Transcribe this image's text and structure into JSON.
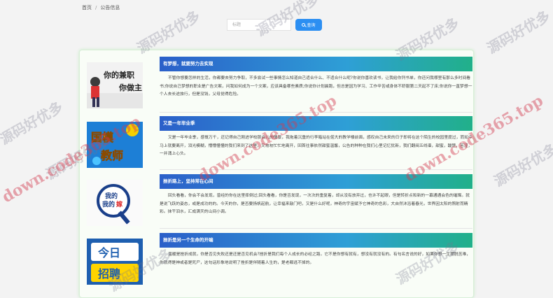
{
  "breadcrumb": {
    "home": "首页",
    "separator": "/",
    "current": "公告信息"
  },
  "search": {
    "placeholder": "标题",
    "button_label": "查询"
  },
  "articles": [
    {
      "title": "有梦想，就要努力去实现",
      "excerpt": "不管你想要怎样的生活，你都要去努力争取，不多尝试一些事情怎么知道自己适合什么、不适合什么呢?你说你喜欢读书，让我给你列书单，你还问我哪里有那么多时间看书;你说自己梦想的职业是广告文案，问我如何成为一个文案，应该具备哪些素质;你说你计划晨跑，但总是因为学习、工作辛苦或身体不舒服第二天起不了床;你说你一直梦想一个人去长途旅行，但是没钱，父母觉得危险。",
      "thumb_text": [
        "你的兼职",
        "你做主"
      ]
    },
    {
      "title": "又是一年毕业季",
      "excerpt": "又是一年毕业季，感慨万千，还记得自己刚进学校那会儿的情景，我拖着沉重的行李箱站在偌大的教学楼前面，感叹自己未来的日子即将在这个陌生的校园里度过，而如今马上就要离开，泪光模糊，懵懵懂懂的我们来到了这里，又匆匆忙忙地离开，回首往事依然甜蜜温馨，公告的种种在我们心里记忆犹新，我们翻阅五线谱，甜蜜，酸楚，苦涩，一并涌上心头。",
      "thumb_text": [
        "国模",
        "教师"
      ]
    },
    {
      "title": "挫折路上，坚持常在心间",
      "excerpt": "回头看看，你会不会发现，曾经的你在这里摔倒过;回头看看，你是否发现，一次次的重复着，却从没有放弃过，也许不起眼，但是转折点和新的一幕通通会色的璀璨。就是说飞跃的姿态，或是成功的的。今天的你，是否要扬帆起航，让幸福来敲门吧，又是什么好呢，神奇的宇宙赋予它神奇的色彩，大自然沐浴着春光，世界因太阳的照射而精彩。抹干泪水，汇成满天的山间小调。",
      "thumb_text": [
        "我的",
        "我的",
        "嫁"
      ]
    },
    {
      "title": "挫折是另一个生命的开端",
      "excerpt": "温暖是挫折成就，你是否见失败还是还是否见机会?挫折是我们每个人成长的必经之路，它不是你想有就有，想没有就没有的。有句名言说的好，如果你想一生摆脱苦难，你就得是神或者是死尸，这句话形象地说明了挫折是伴随着人生的，是老都逃不掉的。",
      "thumb_text": [
        "今日",
        "招聘"
      ]
    }
  ],
  "watermarks": {
    "site_cn": "源码好优多",
    "site_url": "down.code365.top"
  }
}
